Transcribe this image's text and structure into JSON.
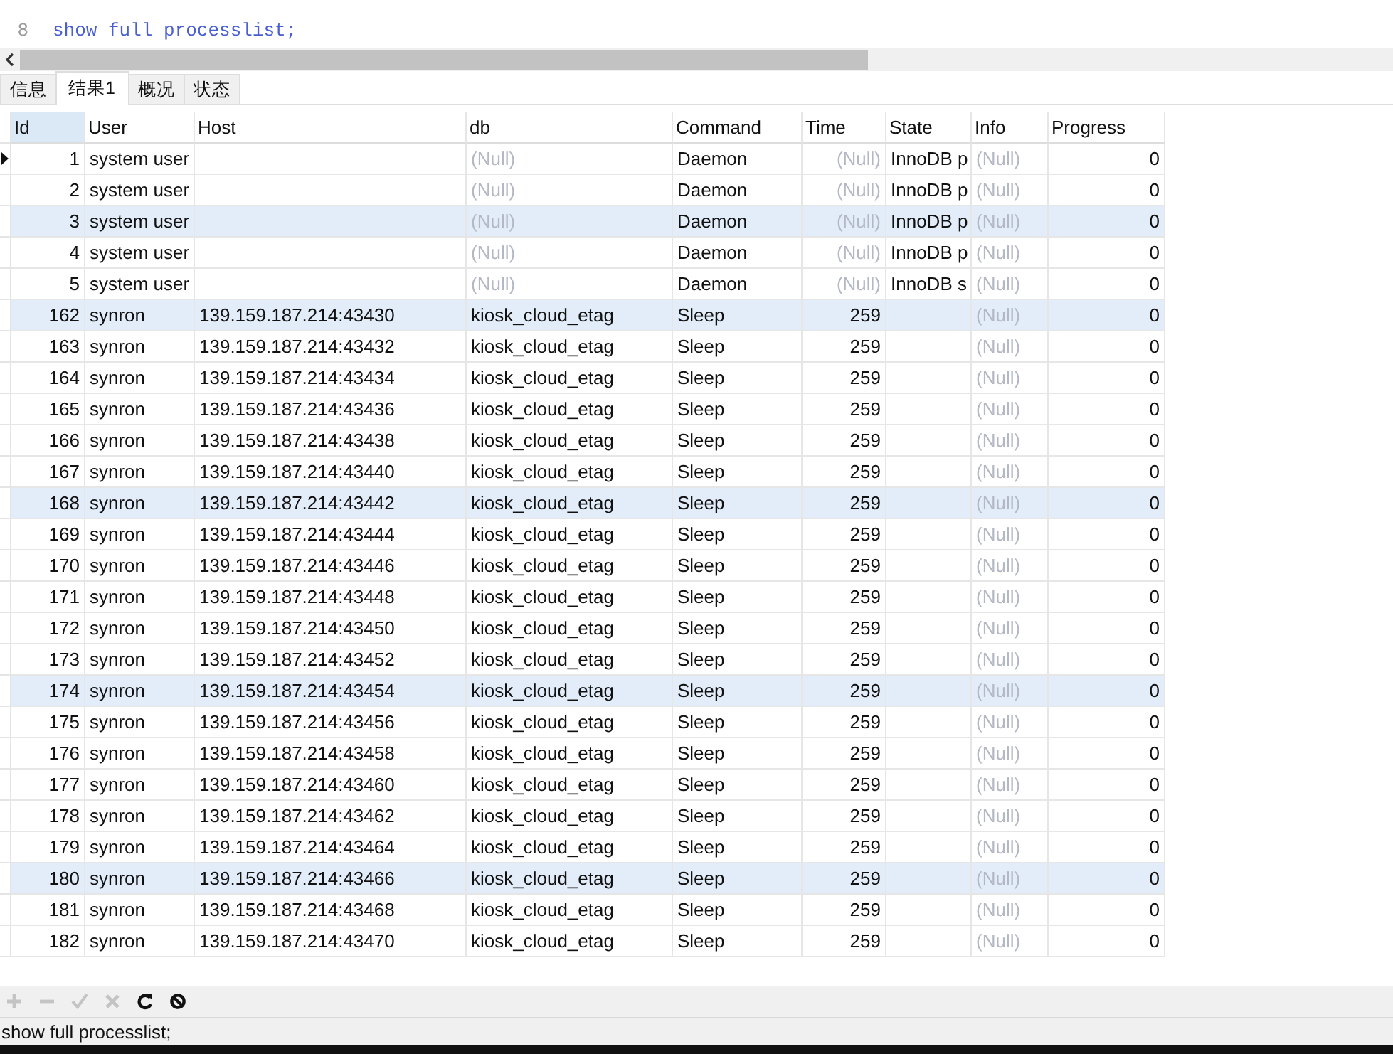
{
  "editor": {
    "lines": [
      {
        "number": "8",
        "code": "show full processlist;"
      }
    ]
  },
  "tabs": [
    {
      "label": "信息",
      "selected": false
    },
    {
      "label": "结果1",
      "selected": true
    },
    {
      "label": "概况",
      "selected": false
    },
    {
      "label": "状态",
      "selected": false
    }
  ],
  "table": {
    "columns": [
      {
        "label": "Id",
        "selected": true
      },
      {
        "label": "User",
        "selected": false
      },
      {
        "label": "Host",
        "selected": false
      },
      {
        "label": "db",
        "selected": false
      },
      {
        "label": "Command",
        "selected": false
      },
      {
        "label": "Time",
        "selected": false
      },
      {
        "label": "State",
        "selected": false
      },
      {
        "label": "Info",
        "selected": false
      },
      {
        "label": "Progress",
        "selected": false
      }
    ],
    "rows": [
      {
        "selected": true,
        "shaded": false,
        "cells": [
          {
            "kind": "value",
            "text": "1"
          },
          {
            "kind": "value",
            "text": "system user"
          },
          {
            "kind": "empty"
          },
          {
            "kind": "null",
            "text": "(Null)"
          },
          {
            "kind": "value",
            "text": "Daemon"
          },
          {
            "kind": "null",
            "text": "(Null)"
          },
          {
            "kind": "value",
            "text": "InnoDB p"
          },
          {
            "kind": "null",
            "text": "(Null)"
          },
          {
            "kind": "value",
            "text": "0"
          }
        ]
      },
      {
        "selected": false,
        "shaded": false,
        "cells": [
          {
            "kind": "value",
            "text": "2"
          },
          {
            "kind": "value",
            "text": "system user"
          },
          {
            "kind": "empty"
          },
          {
            "kind": "null",
            "text": "(Null)"
          },
          {
            "kind": "value",
            "text": "Daemon"
          },
          {
            "kind": "null",
            "text": "(Null)"
          },
          {
            "kind": "value",
            "text": "InnoDB p"
          },
          {
            "kind": "null",
            "text": "(Null)"
          },
          {
            "kind": "value",
            "text": "0"
          }
        ]
      },
      {
        "selected": false,
        "shaded": true,
        "cells": [
          {
            "kind": "value",
            "text": "3"
          },
          {
            "kind": "value",
            "text": "system user"
          },
          {
            "kind": "empty"
          },
          {
            "kind": "null",
            "text": "(Null)"
          },
          {
            "kind": "value",
            "text": "Daemon"
          },
          {
            "kind": "null",
            "text": "(Null)"
          },
          {
            "kind": "value",
            "text": "InnoDB p"
          },
          {
            "kind": "null",
            "text": "(Null)"
          },
          {
            "kind": "value",
            "text": "0"
          }
        ]
      },
      {
        "selected": false,
        "shaded": false,
        "cells": [
          {
            "kind": "value",
            "text": "4"
          },
          {
            "kind": "value",
            "text": "system user"
          },
          {
            "kind": "empty"
          },
          {
            "kind": "null",
            "text": "(Null)"
          },
          {
            "kind": "value",
            "text": "Daemon"
          },
          {
            "kind": "null",
            "text": "(Null)"
          },
          {
            "kind": "value",
            "text": "InnoDB p"
          },
          {
            "kind": "null",
            "text": "(Null)"
          },
          {
            "kind": "value",
            "text": "0"
          }
        ]
      },
      {
        "selected": false,
        "shaded": false,
        "cells": [
          {
            "kind": "value",
            "text": "5"
          },
          {
            "kind": "value",
            "text": "system user"
          },
          {
            "kind": "empty"
          },
          {
            "kind": "null",
            "text": "(Null)"
          },
          {
            "kind": "value",
            "text": "Daemon"
          },
          {
            "kind": "null",
            "text": "(Null)"
          },
          {
            "kind": "value",
            "text": "InnoDB s"
          },
          {
            "kind": "null",
            "text": "(Null)"
          },
          {
            "kind": "value",
            "text": "0"
          }
        ]
      },
      {
        "selected": false,
        "shaded": true,
        "cells": [
          {
            "kind": "value",
            "text": "162"
          },
          {
            "kind": "value",
            "text": "synron"
          },
          {
            "kind": "value",
            "text": "139.159.187.214:43430"
          },
          {
            "kind": "value",
            "text": "kiosk_cloud_etag"
          },
          {
            "kind": "value",
            "text": "Sleep"
          },
          {
            "kind": "value",
            "text": "259"
          },
          {
            "kind": "empty"
          },
          {
            "kind": "null",
            "text": "(Null)"
          },
          {
            "kind": "value",
            "text": "0"
          }
        ]
      },
      {
        "selected": false,
        "shaded": false,
        "cells": [
          {
            "kind": "value",
            "text": "163"
          },
          {
            "kind": "value",
            "text": "synron"
          },
          {
            "kind": "value",
            "text": "139.159.187.214:43432"
          },
          {
            "kind": "value",
            "text": "kiosk_cloud_etag"
          },
          {
            "kind": "value",
            "text": "Sleep"
          },
          {
            "kind": "value",
            "text": "259"
          },
          {
            "kind": "empty"
          },
          {
            "kind": "null",
            "text": "(Null)"
          },
          {
            "kind": "value",
            "text": "0"
          }
        ]
      },
      {
        "selected": false,
        "shaded": false,
        "cells": [
          {
            "kind": "value",
            "text": "164"
          },
          {
            "kind": "value",
            "text": "synron"
          },
          {
            "kind": "value",
            "text": "139.159.187.214:43434"
          },
          {
            "kind": "value",
            "text": "kiosk_cloud_etag"
          },
          {
            "kind": "value",
            "text": "Sleep"
          },
          {
            "kind": "value",
            "text": "259"
          },
          {
            "kind": "empty"
          },
          {
            "kind": "null",
            "text": "(Null)"
          },
          {
            "kind": "value",
            "text": "0"
          }
        ]
      },
      {
        "selected": false,
        "shaded": false,
        "cells": [
          {
            "kind": "value",
            "text": "165"
          },
          {
            "kind": "value",
            "text": "synron"
          },
          {
            "kind": "value",
            "text": "139.159.187.214:43436"
          },
          {
            "kind": "value",
            "text": "kiosk_cloud_etag"
          },
          {
            "kind": "value",
            "text": "Sleep"
          },
          {
            "kind": "value",
            "text": "259"
          },
          {
            "kind": "empty"
          },
          {
            "kind": "null",
            "text": "(Null)"
          },
          {
            "kind": "value",
            "text": "0"
          }
        ]
      },
      {
        "selected": false,
        "shaded": false,
        "cells": [
          {
            "kind": "value",
            "text": "166"
          },
          {
            "kind": "value",
            "text": "synron"
          },
          {
            "kind": "value",
            "text": "139.159.187.214:43438"
          },
          {
            "kind": "value",
            "text": "kiosk_cloud_etag"
          },
          {
            "kind": "value",
            "text": "Sleep"
          },
          {
            "kind": "value",
            "text": "259"
          },
          {
            "kind": "empty"
          },
          {
            "kind": "null",
            "text": "(Null)"
          },
          {
            "kind": "value",
            "text": "0"
          }
        ]
      },
      {
        "selected": false,
        "shaded": false,
        "cells": [
          {
            "kind": "value",
            "text": "167"
          },
          {
            "kind": "value",
            "text": "synron"
          },
          {
            "kind": "value",
            "text": "139.159.187.214:43440"
          },
          {
            "kind": "value",
            "text": "kiosk_cloud_etag"
          },
          {
            "kind": "value",
            "text": "Sleep"
          },
          {
            "kind": "value",
            "text": "259"
          },
          {
            "kind": "empty"
          },
          {
            "kind": "null",
            "text": "(Null)"
          },
          {
            "kind": "value",
            "text": "0"
          }
        ]
      },
      {
        "selected": false,
        "shaded": true,
        "cells": [
          {
            "kind": "value",
            "text": "168"
          },
          {
            "kind": "value",
            "text": "synron"
          },
          {
            "kind": "value",
            "text": "139.159.187.214:43442"
          },
          {
            "kind": "value",
            "text": "kiosk_cloud_etag"
          },
          {
            "kind": "value",
            "text": "Sleep"
          },
          {
            "kind": "value",
            "text": "259"
          },
          {
            "kind": "empty"
          },
          {
            "kind": "null",
            "text": "(Null)"
          },
          {
            "kind": "value",
            "text": "0"
          }
        ]
      },
      {
        "selected": false,
        "shaded": false,
        "cells": [
          {
            "kind": "value",
            "text": "169"
          },
          {
            "kind": "value",
            "text": "synron"
          },
          {
            "kind": "value",
            "text": "139.159.187.214:43444"
          },
          {
            "kind": "value",
            "text": "kiosk_cloud_etag"
          },
          {
            "kind": "value",
            "text": "Sleep"
          },
          {
            "kind": "value",
            "text": "259"
          },
          {
            "kind": "empty"
          },
          {
            "kind": "null",
            "text": "(Null)"
          },
          {
            "kind": "value",
            "text": "0"
          }
        ]
      },
      {
        "selected": false,
        "shaded": false,
        "cells": [
          {
            "kind": "value",
            "text": "170"
          },
          {
            "kind": "value",
            "text": "synron"
          },
          {
            "kind": "value",
            "text": "139.159.187.214:43446"
          },
          {
            "kind": "value",
            "text": "kiosk_cloud_etag"
          },
          {
            "kind": "value",
            "text": "Sleep"
          },
          {
            "kind": "value",
            "text": "259"
          },
          {
            "kind": "empty"
          },
          {
            "kind": "null",
            "text": "(Null)"
          },
          {
            "kind": "value",
            "text": "0"
          }
        ]
      },
      {
        "selected": false,
        "shaded": false,
        "cells": [
          {
            "kind": "value",
            "text": "171"
          },
          {
            "kind": "value",
            "text": "synron"
          },
          {
            "kind": "value",
            "text": "139.159.187.214:43448"
          },
          {
            "kind": "value",
            "text": "kiosk_cloud_etag"
          },
          {
            "kind": "value",
            "text": "Sleep"
          },
          {
            "kind": "value",
            "text": "259"
          },
          {
            "kind": "empty"
          },
          {
            "kind": "null",
            "text": "(Null)"
          },
          {
            "kind": "value",
            "text": "0"
          }
        ]
      },
      {
        "selected": false,
        "shaded": false,
        "cells": [
          {
            "kind": "value",
            "text": "172"
          },
          {
            "kind": "value",
            "text": "synron"
          },
          {
            "kind": "value",
            "text": "139.159.187.214:43450"
          },
          {
            "kind": "value",
            "text": "kiosk_cloud_etag"
          },
          {
            "kind": "value",
            "text": "Sleep"
          },
          {
            "kind": "value",
            "text": "259"
          },
          {
            "kind": "empty"
          },
          {
            "kind": "null",
            "text": "(Null)"
          },
          {
            "kind": "value",
            "text": "0"
          }
        ]
      },
      {
        "selected": false,
        "shaded": false,
        "cells": [
          {
            "kind": "value",
            "text": "173"
          },
          {
            "kind": "value",
            "text": "synron"
          },
          {
            "kind": "value",
            "text": "139.159.187.214:43452"
          },
          {
            "kind": "value",
            "text": "kiosk_cloud_etag"
          },
          {
            "kind": "value",
            "text": "Sleep"
          },
          {
            "kind": "value",
            "text": "259"
          },
          {
            "kind": "empty"
          },
          {
            "kind": "null",
            "text": "(Null)"
          },
          {
            "kind": "value",
            "text": "0"
          }
        ]
      },
      {
        "selected": false,
        "shaded": true,
        "cells": [
          {
            "kind": "value",
            "text": "174"
          },
          {
            "kind": "value",
            "text": "synron"
          },
          {
            "kind": "value",
            "text": "139.159.187.214:43454"
          },
          {
            "kind": "value",
            "text": "kiosk_cloud_etag"
          },
          {
            "kind": "value",
            "text": "Sleep"
          },
          {
            "kind": "value",
            "text": "259"
          },
          {
            "kind": "empty"
          },
          {
            "kind": "null",
            "text": "(Null)"
          },
          {
            "kind": "value",
            "text": "0"
          }
        ]
      },
      {
        "selected": false,
        "shaded": false,
        "cells": [
          {
            "kind": "value",
            "text": "175"
          },
          {
            "kind": "value",
            "text": "synron"
          },
          {
            "kind": "value",
            "text": "139.159.187.214:43456"
          },
          {
            "kind": "value",
            "text": "kiosk_cloud_etag"
          },
          {
            "kind": "value",
            "text": "Sleep"
          },
          {
            "kind": "value",
            "text": "259"
          },
          {
            "kind": "empty"
          },
          {
            "kind": "null",
            "text": "(Null)"
          },
          {
            "kind": "value",
            "text": "0"
          }
        ]
      },
      {
        "selected": false,
        "shaded": false,
        "cells": [
          {
            "kind": "value",
            "text": "176"
          },
          {
            "kind": "value",
            "text": "synron"
          },
          {
            "kind": "value",
            "text": "139.159.187.214:43458"
          },
          {
            "kind": "value",
            "text": "kiosk_cloud_etag"
          },
          {
            "kind": "value",
            "text": "Sleep"
          },
          {
            "kind": "value",
            "text": "259"
          },
          {
            "kind": "empty"
          },
          {
            "kind": "null",
            "text": "(Null)"
          },
          {
            "kind": "value",
            "text": "0"
          }
        ]
      },
      {
        "selected": false,
        "shaded": false,
        "cells": [
          {
            "kind": "value",
            "text": "177"
          },
          {
            "kind": "value",
            "text": "synron"
          },
          {
            "kind": "value",
            "text": "139.159.187.214:43460"
          },
          {
            "kind": "value",
            "text": "kiosk_cloud_etag"
          },
          {
            "kind": "value",
            "text": "Sleep"
          },
          {
            "kind": "value",
            "text": "259"
          },
          {
            "kind": "empty"
          },
          {
            "kind": "null",
            "text": "(Null)"
          },
          {
            "kind": "value",
            "text": "0"
          }
        ]
      },
      {
        "selected": false,
        "shaded": false,
        "cells": [
          {
            "kind": "value",
            "text": "178"
          },
          {
            "kind": "value",
            "text": "synron"
          },
          {
            "kind": "value",
            "text": "139.159.187.214:43462"
          },
          {
            "kind": "value",
            "text": "kiosk_cloud_etag"
          },
          {
            "kind": "value",
            "text": "Sleep"
          },
          {
            "kind": "value",
            "text": "259"
          },
          {
            "kind": "empty"
          },
          {
            "kind": "null",
            "text": "(Null)"
          },
          {
            "kind": "value",
            "text": "0"
          }
        ]
      },
      {
        "selected": false,
        "shaded": false,
        "cells": [
          {
            "kind": "value",
            "text": "179"
          },
          {
            "kind": "value",
            "text": "synron"
          },
          {
            "kind": "value",
            "text": "139.159.187.214:43464"
          },
          {
            "kind": "value",
            "text": "kiosk_cloud_etag"
          },
          {
            "kind": "value",
            "text": "Sleep"
          },
          {
            "kind": "value",
            "text": "259"
          },
          {
            "kind": "empty"
          },
          {
            "kind": "null",
            "text": "(Null)"
          },
          {
            "kind": "value",
            "text": "0"
          }
        ]
      },
      {
        "selected": false,
        "shaded": true,
        "cells": [
          {
            "kind": "value",
            "text": "180"
          },
          {
            "kind": "value",
            "text": "synron"
          },
          {
            "kind": "value",
            "text": "139.159.187.214:43466"
          },
          {
            "kind": "value",
            "text": "kiosk_cloud_etag"
          },
          {
            "kind": "value",
            "text": "Sleep"
          },
          {
            "kind": "value",
            "text": "259"
          },
          {
            "kind": "empty"
          },
          {
            "kind": "null",
            "text": "(Null)"
          },
          {
            "kind": "value",
            "text": "0"
          }
        ]
      },
      {
        "selected": false,
        "shaded": false,
        "cells": [
          {
            "kind": "value",
            "text": "181"
          },
          {
            "kind": "value",
            "text": "synron"
          },
          {
            "kind": "value",
            "text": "139.159.187.214:43468"
          },
          {
            "kind": "value",
            "text": "kiosk_cloud_etag"
          },
          {
            "kind": "value",
            "text": "Sleep"
          },
          {
            "kind": "value",
            "text": "259"
          },
          {
            "kind": "empty"
          },
          {
            "kind": "null",
            "text": "(Null)"
          },
          {
            "kind": "value",
            "text": "0"
          }
        ]
      },
      {
        "selected": false,
        "shaded": false,
        "cells": [
          {
            "kind": "value",
            "text": "182"
          },
          {
            "kind": "value",
            "text": "synron"
          },
          {
            "kind": "value",
            "text": "139.159.187.214:43470"
          },
          {
            "kind": "value",
            "text": "kiosk_cloud_etag"
          },
          {
            "kind": "value",
            "text": "Sleep"
          },
          {
            "kind": "value",
            "text": "259"
          },
          {
            "kind": "empty"
          },
          {
            "kind": "null",
            "text": "(Null)"
          },
          {
            "kind": "value",
            "text": "0"
          }
        ]
      }
    ]
  },
  "toolbar": [
    {
      "kind": "add",
      "disabled": true
    },
    {
      "kind": "remove",
      "disabled": true
    },
    {
      "kind": "apply",
      "disabled": true
    },
    {
      "kind": "cancel",
      "disabled": true
    },
    {
      "kind": "refresh",
      "disabled": false
    },
    {
      "kind": "stop",
      "disabled": false
    }
  ],
  "status_bar": {
    "text": "show full processlist;"
  }
}
